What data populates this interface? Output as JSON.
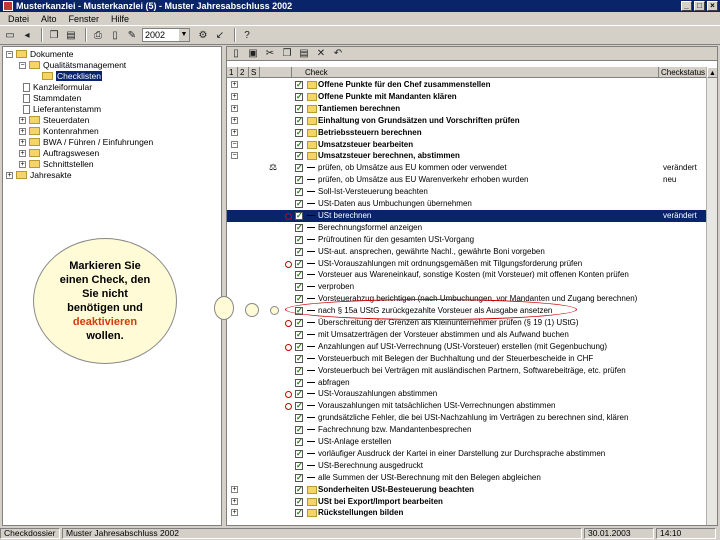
{
  "window": {
    "title": "Musterkanzlei - Musterkanzlei (5) - Muster Jahresabschluss 2002",
    "min": "_",
    "max": "□",
    "close": "×"
  },
  "menu": [
    "Datei",
    "Alto",
    "Fenster",
    "Hilfe"
  ],
  "toolbar": {
    "year": "2002"
  },
  "tree": {
    "root": "Dokumente",
    "items": [
      {
        "label": "Qualitätsmanagement",
        "level": 1,
        "type": "folder",
        "expander": "−"
      },
      {
        "label": "Checklisten",
        "level": 2,
        "type": "folder",
        "selected": true
      },
      {
        "label": "Kanzleiformular",
        "level": 1,
        "type": "doc"
      },
      {
        "label": "Stammdaten",
        "level": 1,
        "type": "doc"
      },
      {
        "label": "Lieferantenstamm",
        "level": 1,
        "type": "doc"
      },
      {
        "label": "Steuerdaten",
        "level": 1,
        "type": "folder",
        "expander": "+"
      },
      {
        "label": "Kontenrahmen",
        "level": 1,
        "type": "folder",
        "expander": "+"
      },
      {
        "label": "BWA / Führen / Einfuhrungen",
        "level": 1,
        "type": "folder",
        "expander": "+"
      },
      {
        "label": "Auftragswesen",
        "level": 1,
        "type": "folder",
        "expander": "+"
      },
      {
        "label": "Schnittstellen",
        "level": 1,
        "type": "folder",
        "expander": "+"
      }
    ],
    "bottom": "Jahresakte"
  },
  "grid": {
    "headers": {
      "col1": "1",
      "col2": "2",
      "col3": "S",
      "check": "Check",
      "status": "Checkstatus"
    },
    "rows": [
      {
        "text": "Offene Punkte für den Chef zusammenstellen",
        "bold": true,
        "folder": true,
        "exp": "+"
      },
      {
        "text": "Offene Punkte mit Mandanten klären",
        "bold": true,
        "folder": true,
        "exp": "+"
      },
      {
        "text": "Tantiemen berechnen",
        "bold": true,
        "folder": true,
        "exp": "+"
      },
      {
        "text": "Einhaltung von Grundsätzen und Vorschriften prüfen",
        "bold": true,
        "folder": true,
        "exp": "+"
      },
      {
        "text": "Betriebssteuern berechnen",
        "bold": true,
        "folder": true,
        "exp": "+"
      },
      {
        "text": "Umsatzsteuer bearbeiten",
        "bold": true,
        "folder": true,
        "exp": "−"
      },
      {
        "text": "Umsatzsteuer berechnen, abstimmen",
        "bold": true,
        "folder": true,
        "exp": "−"
      },
      {
        "text": "prüfen, ob Umsätze aus EU kommen oder verwendet",
        "status": "verändert",
        "mark": "⚖"
      },
      {
        "text": "prüfen, ob Umsätze aus EU Warenverkehr erhoben wurden",
        "status": "neu"
      },
      {
        "text": "Soll-Ist-Versteuerung beachten"
      },
      {
        "text": "USt-Daten aus Umbuchungen übernehmen"
      },
      {
        "text": "USt berechnen",
        "status": "verändert",
        "selected": true,
        "red": true
      },
      {
        "text": "Berechnungsformel anzeigen"
      },
      {
        "text": "Prüfroutinen für den gesamten USt-Vorgang"
      },
      {
        "text": "USt-aut. ansprechen, gewährte Nachl., gewährte Boni vorgeben"
      },
      {
        "text": "USt-Vorauszahlungen mit ordnungsgemäßen mit Tilgungsforderung prüfen",
        "red": true
      },
      {
        "text": "Vorsteuer aus Wareneinkauf, sonstige Kosten (mit Vorsteuer) mit offenen Konten prüfen"
      },
      {
        "text": "verproben"
      },
      {
        "text": "Vorsteuerabzug berichtigen (nach Umbuchungen, vor Mandanten und Zugang berechnen)"
      },
      {
        "text": "nach § 15a UStG zurückgezahlte Vorsteuer als Ausgabe ansetzen"
      },
      {
        "text": "Überschreitung der Grenzen als Kleinunternehmer prüfen (§ 19 (1) UStG)",
        "red": true
      },
      {
        "text": "mit Umsatzerträgen der Vorsteuer abstimmen und als Aufwand buchen"
      },
      {
        "text": "Anzahlungen auf USt-Verrechnung (USt-Vorsteuer) erstellen (mit Gegenbuchung)",
        "red": true
      },
      {
        "text": "Vorsteuerbuch mit Belegen der Buchhaltung und der Steuerbescheide in CHF"
      },
      {
        "text": "Vorsteuerbuch bei Verträgen mit ausländischen Partnern, Softwarebeiträge, etc. prüfen"
      },
      {
        "text": "abfragen"
      },
      {
        "text": "USt-Vorauszahlungen abstimmen",
        "red": true
      },
      {
        "text": "Vorauszahlungen mit tatsächlichen USt-Verrechnungen abstimmen",
        "red": true
      },
      {
        "text": "grundsätzliche Fehler, die bei USt-Nachzahlung im Verträgen zu berechnen sind, klären"
      },
      {
        "text": "Fachrechnung bzw. Mandantenbesprechen"
      },
      {
        "text": "USt-Anlage erstellen"
      },
      {
        "text": "vorläufiger Ausdruck der Kartei in einer Darstellung zur Durchsprache abstimmen"
      },
      {
        "text": "USt-Berechnung ausgedruckt"
      },
      {
        "text": "alle Summen der USt-Berechnung mit den Belegen abgleichen"
      },
      {
        "text": "Sonderheiten USt-Besteuerung beachten",
        "bold": true,
        "folder": true,
        "exp": "+"
      },
      {
        "text": "USt bei Export/Import bearbeiten",
        "bold": true,
        "folder": true,
        "exp": "+"
      },
      {
        "text": "Rückstellungen bilden",
        "bold": true,
        "folder": true,
        "exp": "+"
      }
    ]
  },
  "callout": {
    "line1": "Markieren Sie",
    "line2": "einen Check, den",
    "line3": "Sie nicht",
    "line4": "benötigen und",
    "line5": "deaktivieren",
    "line6": "wollen."
  },
  "statusbar": {
    "left": "Checkdossier",
    "mid": "Muster Jahresabschluss 2002",
    "date": "30.01.2003",
    "time": "14:10"
  },
  "colors": {
    "accent": "#0a246a",
    "highlight_word": "#d43a0a",
    "circle": "#cc0000"
  }
}
